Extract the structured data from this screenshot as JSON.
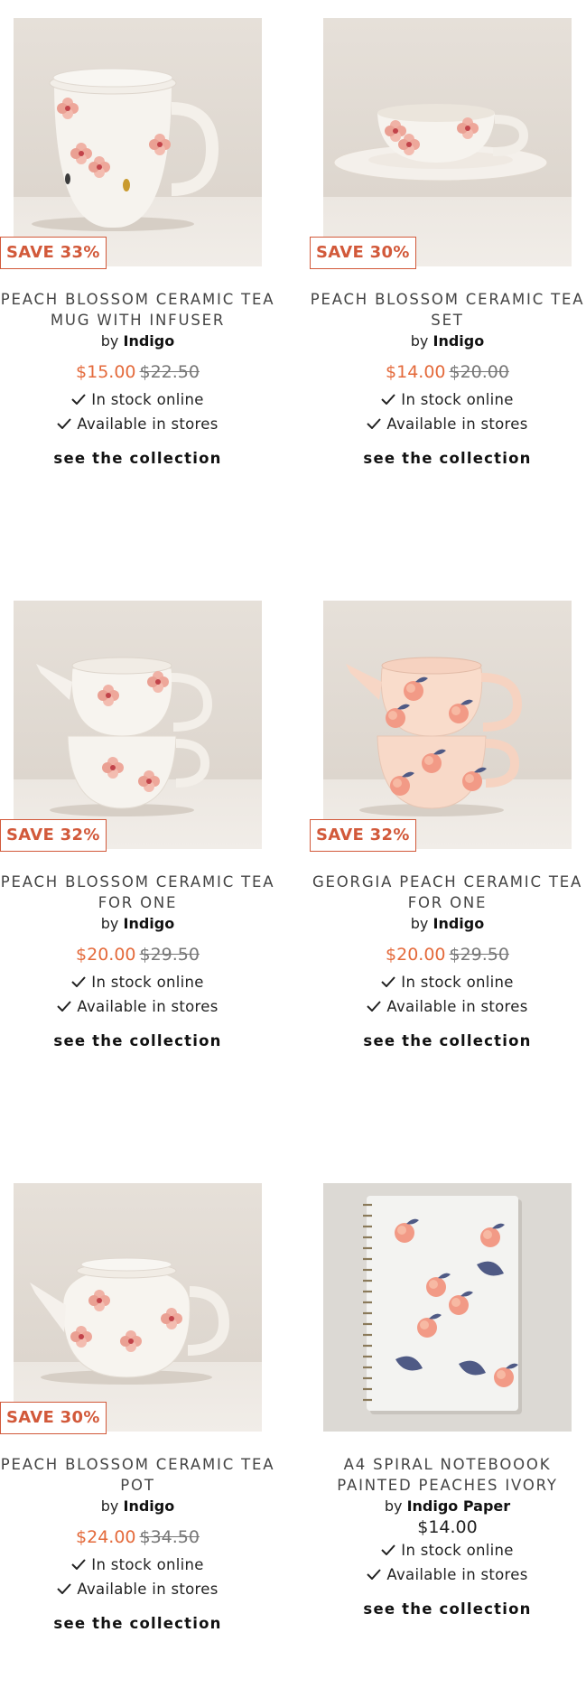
{
  "colors": {
    "sale": "#e46a3b",
    "badge": "#d2593a",
    "text": "#222222"
  },
  "products": [
    {
      "badge": "SAVE 33%",
      "title_line1": "PEACH BLOSSOM CERAMIC TEA",
      "title_line2": "MUG WITH INFUSER",
      "by": "by",
      "brand": "Indigo",
      "sale_price": "$15.00",
      "original_price": "$22.50",
      "stock": "In stock online",
      "stores": "Available in stores",
      "link": "see the collection",
      "image": "tea-mug-with-infuser"
    },
    {
      "badge": "SAVE 30%",
      "title_line1": "PEACH BLOSSOM CERAMIC TEA",
      "title_line2": "SET",
      "by": "by",
      "brand": "Indigo",
      "sale_price": "$14.00",
      "original_price": "$20.00",
      "stock": "In stock online",
      "stores": "Available in stores",
      "link": "see the collection",
      "image": "tea-cup-and-saucer"
    },
    {
      "badge": "SAVE 32%",
      "title_line1": "PEACH BLOSSOM CERAMIC TEA",
      "title_line2": "FOR ONE",
      "by": "by",
      "brand": "Indigo",
      "sale_price": "$20.00",
      "original_price": "$29.50",
      "stock": "In stock online",
      "stores": "Available in stores",
      "link": "see the collection",
      "image": "tea-for-one-blossom"
    },
    {
      "badge": "SAVE 32%",
      "title_line1": "GEORGIA PEACH CERAMIC TEA",
      "title_line2": "FOR ONE",
      "by": "by",
      "brand": "Indigo",
      "sale_price": "$20.00",
      "original_price": "$29.50",
      "stock": "In stock online",
      "stores": "Available in stores",
      "link": "see the collection",
      "image": "tea-for-one-peach"
    },
    {
      "badge": "SAVE 30%",
      "title_line1": "PEACH BLOSSOM CERAMIC TEA",
      "title_line2": "POT",
      "by": "by",
      "brand": "Indigo",
      "sale_price": "$24.00",
      "original_price": "$34.50",
      "stock": "In stock online",
      "stores": "Available in stores",
      "link": "see the collection",
      "image": "teapot"
    },
    {
      "title_line1": "A4 SPIRAL NOTEBOOOK",
      "title_line2": "PAINTED PEACHES IVORY",
      "by": "by",
      "brand": "Indigo Paper",
      "price": "$14.00",
      "stock": "In stock online",
      "stores": "Available in stores",
      "link": "see the collection",
      "image": "spiral-notebook"
    }
  ]
}
